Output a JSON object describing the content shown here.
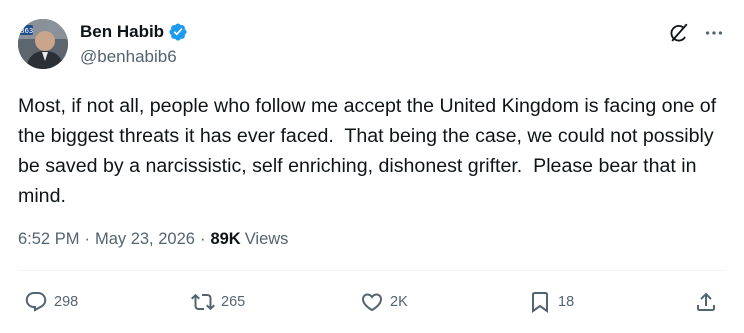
{
  "author": {
    "display_name": "Ben Habib",
    "handle": "@benhabib6",
    "avatar_badge": "863"
  },
  "tweet": {
    "text": "Most, if not all, people who follow me accept the United Kingdom is facing one of the biggest threats it has ever faced.  That being the case, we could not possibly be saved by a narcissistic, self enriching, dishonest grifter.  Please bear that in mind."
  },
  "meta": {
    "time": "6:52 PM",
    "separator": "·",
    "date": "May 23, 2026",
    "views_count": "89K",
    "views_label": "Views"
  },
  "actions": {
    "replies": "298",
    "reposts": "265",
    "likes": "2K",
    "bookmarks": "18"
  },
  "colors": {
    "text_primary": "#0f1419",
    "text_secondary": "#536471",
    "verified_blue": "#1d9bf0",
    "divider": "#eff3f4"
  },
  "icons": [
    "verified-badge-icon",
    "grok-icon",
    "more-icon",
    "reply-icon",
    "repost-icon",
    "like-icon",
    "bookmark-icon",
    "share-icon"
  ]
}
